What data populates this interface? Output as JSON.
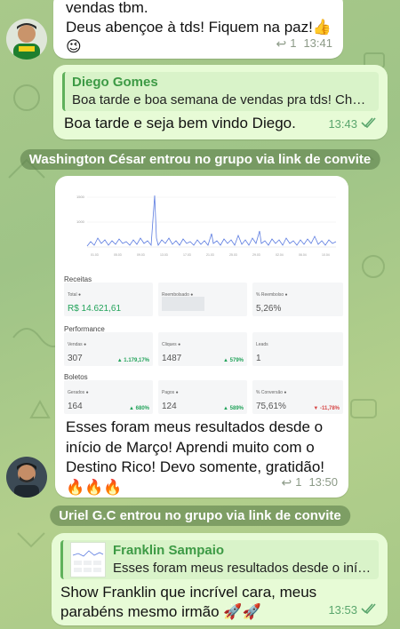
{
  "messages": {
    "m1": {
      "lines": [
        "vendas tbm.",
        "Deus abençoe à tds! Fiquem na paz!👍",
        "😉"
      ],
      "replies": "1",
      "time": "13:41"
    },
    "m2": {
      "quote_name": "Diego Gomes",
      "quote_text": "Boa tarde e boa semana de vendas pra tds! Cheg…",
      "text": "Boa tarde e seja bem vindo Diego.",
      "time": "13:43"
    },
    "service1": "Washington César entrou no grupo via link de convite",
    "m3": {
      "caption_lines": [
        "Esses foram meus resultados desde o",
        "início de Março! Aprendi muito com o",
        "Destino Rico! Devo somente, gratidão!",
        "🔥🔥🔥"
      ],
      "replies": "1",
      "time": "13:50"
    },
    "service2": "Uriel G.C entrou no grupo via link de convite",
    "m4": {
      "quote_name": "Franklin Sampaio",
      "quote_text": "Esses foram meus resultados desde o iníc…",
      "lines": [
        "Show Franklin que incrível cara, meus",
        "parabéns mesmo irmão 🚀🚀"
      ],
      "time": "13:53"
    }
  },
  "dashboard": {
    "sections": {
      "receitas": "Receitas",
      "performance": "Performance",
      "boletos": "Boletos"
    },
    "cards": {
      "total": {
        "label": "Total ●",
        "value": "R$ 14.621,61"
      },
      "reemb": {
        "label": "Reembolsado ●",
        "value": ""
      },
      "preemb": {
        "label": "% Reembolso ●",
        "value": "5,26%"
      },
      "vendas": {
        "label": "Vendas ●",
        "value": "307",
        "delta": "▲ 1.179,17%"
      },
      "cliques": {
        "label": "Cliques ●",
        "value": "1487",
        "delta": "▲ 579%"
      },
      "leads": {
        "label": "Leads",
        "value": "1"
      },
      "gerados": {
        "label": "Gerados ●",
        "value": "164",
        "delta": "▲ 680%"
      },
      "pagos": {
        "label": "Pagos ●",
        "value": "124",
        "delta": "▲ 589%"
      },
      "conversao": {
        "label": "% Conversão ●",
        "value": "75,61%",
        "delta": "▼ -11,78%"
      }
    }
  },
  "icons": {
    "reply": "reply-icon",
    "double_check": "double-check-icon",
    "avatar": "avatar"
  }
}
